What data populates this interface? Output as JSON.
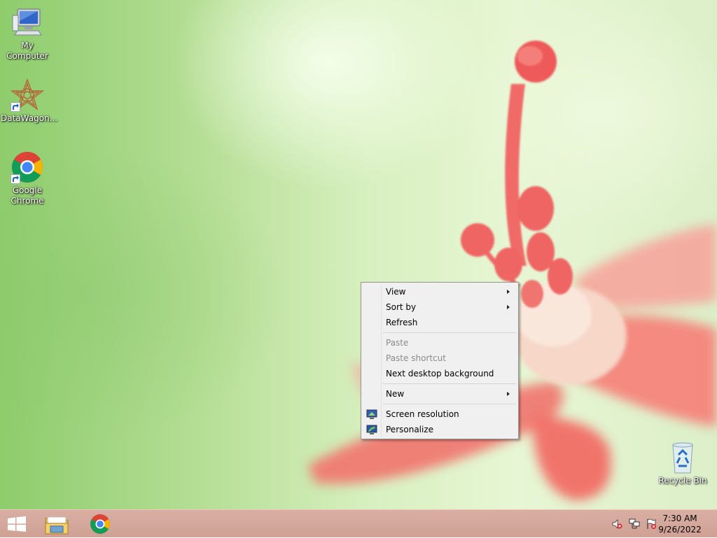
{
  "desktop": {
    "icons": [
      {
        "label": "My Computer",
        "icon": "computer-icon"
      },
      {
        "label": "DataWagon...",
        "icon": "datawagon-icon",
        "shortcut": true
      },
      {
        "label": "Google Chrome",
        "icon": "chrome-icon",
        "shortcut": true
      },
      {
        "label": "Recycle Bin",
        "icon": "recycle-bin-icon"
      }
    ]
  },
  "context_menu": {
    "items": [
      {
        "label": "View",
        "submenu": true,
        "enabled": true
      },
      {
        "label": "Sort by",
        "submenu": true,
        "enabled": true
      },
      {
        "label": "Refresh",
        "enabled": true
      },
      {
        "label": "Paste",
        "enabled": false
      },
      {
        "label": "Paste shortcut",
        "enabled": false
      },
      {
        "label": "Next desktop background",
        "enabled": true
      },
      {
        "label": "New",
        "submenu": true,
        "enabled": true
      },
      {
        "label": "Screen resolution",
        "enabled": true,
        "icon": "screen-resolution-icon"
      },
      {
        "label": "Personalize",
        "enabled": true,
        "icon": "personalize-icon"
      }
    ]
  },
  "taskbar": {
    "pinned": [
      {
        "icon": "windows-start-icon"
      },
      {
        "icon": "file-explorer-icon"
      },
      {
        "icon": "chrome-icon"
      }
    ],
    "tray_icons": [
      "volume-muted-icon",
      "network-icon",
      "action-center-flag-icon"
    ],
    "clock": {
      "time": "7:30 AM",
      "date": "9/26/2022"
    }
  },
  "colors": {
    "taskbar": "#d2a497",
    "menu_bg": "#f0f0f0",
    "disabled_text": "#8a8a8a"
  }
}
